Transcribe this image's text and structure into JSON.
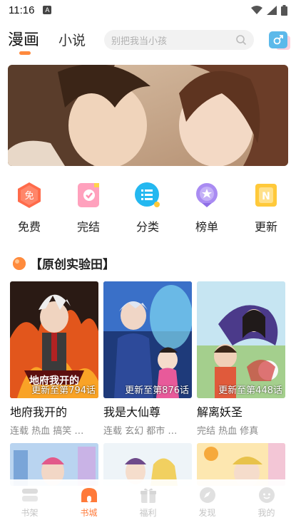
{
  "status_bar": {
    "time": "11:16",
    "notification_badge": "A",
    "icons": [
      "wifi-icon",
      "signal-icon",
      "battery-icon"
    ]
  },
  "top_nav": {
    "tabs": [
      {
        "label": "漫画",
        "active": true
      },
      {
        "label": "小说",
        "active": false
      }
    ],
    "search": {
      "placeholder": "别把我当小孩"
    },
    "icons": [
      "search-icon",
      "gender-toggle-icon"
    ]
  },
  "categories": [
    {
      "label": "免费",
      "icon": "free-icon",
      "inner": "免",
      "color": "#ff6b4a"
    },
    {
      "label": "完结",
      "icon": "completed-icon",
      "color": "#ff8fb1"
    },
    {
      "label": "分类",
      "icon": "category-icon",
      "color": "#24b8f0"
    },
    {
      "label": "榜单",
      "icon": "ranking-icon",
      "color": "#a98bf2"
    },
    {
      "label": "更新",
      "icon": "update-icon",
      "inner": "N",
      "color": "#ffc93a"
    }
  ],
  "section": {
    "title": "【原创实验田】",
    "icon": "section-dot-icon"
  },
  "comics": [
    {
      "title": "地府我开的",
      "update": "更新至第794话",
      "tags": "连载 热血 搞笑 …",
      "cover_logo": "地府我开的"
    },
    {
      "title": "我是大仙尊",
      "update": "更新至第876话",
      "tags": "连载 玄幻 都市 …"
    },
    {
      "title": "解离妖圣",
      "update": "更新至第448话",
      "tags": "完结 热血 修真"
    }
  ],
  "bottom_nav": [
    {
      "label": "书架",
      "icon": "bookshelf-icon",
      "active": false
    },
    {
      "label": "书城",
      "icon": "bookstore-icon",
      "active": true
    },
    {
      "label": "福利",
      "icon": "gift-icon",
      "active": false
    },
    {
      "label": "发现",
      "icon": "discover-icon",
      "active": false
    },
    {
      "label": "我的",
      "icon": "profile-icon",
      "active": false
    }
  ],
  "colors": {
    "accent": "#ff7a3a",
    "inactive": "#c4c4c4"
  }
}
